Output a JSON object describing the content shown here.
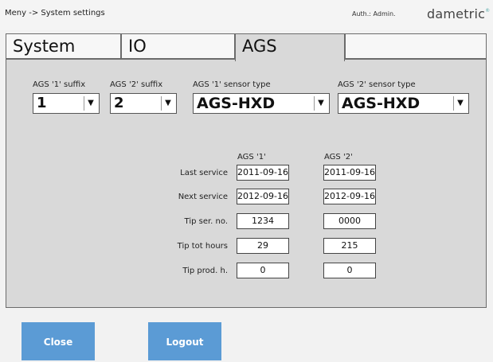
{
  "header": {
    "breadcrumb": "Meny -> System settings",
    "auth": "Auth.: Admin.",
    "logo": "dametric",
    "logo_mark": "®"
  },
  "tabs": [
    {
      "label": "System",
      "active": false
    },
    {
      "label": "IO",
      "active": false
    },
    {
      "label": "AGS",
      "active": true
    },
    {
      "label": "",
      "active": false
    }
  ],
  "ags_settings": {
    "suffix1_label": "AGS '1' suffix",
    "suffix1_value": "1",
    "suffix2_label": "AGS '2' suffix",
    "suffix2_value": "2",
    "sensor1_label": "AGS '1' sensor type",
    "sensor1_value": "AGS-HXD",
    "sensor2_label": "AGS '2' sensor type",
    "sensor2_value": "AGS-HXD"
  },
  "service_table": {
    "col1": "AGS '1'",
    "col2": "AGS '2'",
    "rows": [
      {
        "label": "Last service",
        "ags1": "2011-09-16",
        "ags2": "2011-09-16"
      },
      {
        "label": "Next service",
        "ags1": "2012-09-16",
        "ags2": "2012-09-16"
      },
      {
        "label": "Tip ser. no.",
        "ags1": "1234",
        "ags2": "0000"
      },
      {
        "label": "Tip tot hours",
        "ags1": "29",
        "ags2": "215"
      },
      {
        "label": "Tip prod. h.",
        "ags1": "0",
        "ags2": "0"
      }
    ]
  },
  "buttons": {
    "close": "Close",
    "logout": "Logout"
  },
  "colors": {
    "button": "#5b9bd5",
    "panel": "#d9d9d9",
    "border": "#6b6b6b"
  },
  "icons": {
    "dropdown": "chevron-down-icon"
  }
}
